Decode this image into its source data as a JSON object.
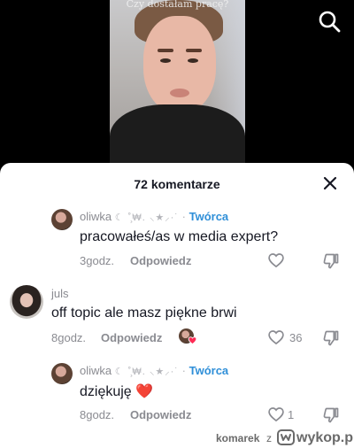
{
  "video": {
    "caption": "Czy dostałam pracę?"
  },
  "sheet": {
    "title": "72 komentarze"
  },
  "comments": [
    {
      "username": "oliwka",
      "decoration": "☾ ˚̧₩. ⸜★⸝·˙",
      "separator": "·",
      "creator_badge": "Twórca",
      "text": "pracowałeś/as w media expert?",
      "time": "3godz.",
      "reply_label": "Odpowiedz",
      "likes": ""
    },
    {
      "username": "juls",
      "text": "off topic ale masz piękne brwi",
      "time": "8godz.",
      "reply_label": "Odpowiedz",
      "likes": "36"
    },
    {
      "username": "oliwka",
      "decoration": "☾ ˚̧₩. ⸜★⸝·˙",
      "separator": "·",
      "creator_badge": "Twórca",
      "text": "dziękuję",
      "emoji": "❤️",
      "time": "8godz.",
      "reply_label": "Odpowiedz",
      "likes": "1"
    }
  ],
  "watermark": {
    "user": "komarek",
    "z": "z",
    "brand": "wykop.pl"
  }
}
